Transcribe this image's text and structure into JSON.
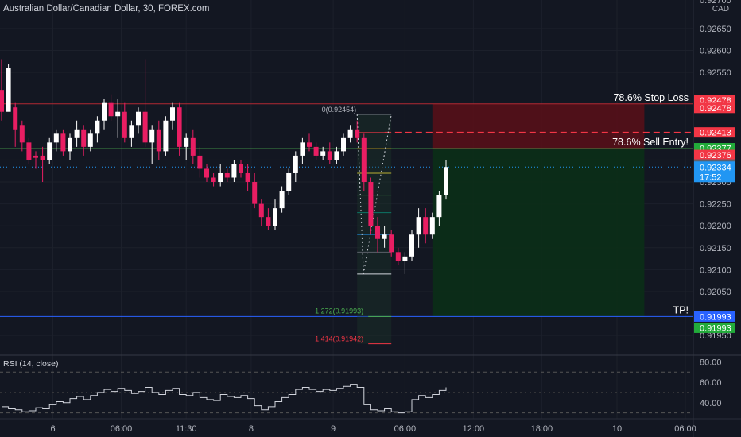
{
  "header": {
    "symbol_title": "Australian Dollar/Canadian Dollar, 30, FOREX.com",
    "currency": "CAD"
  },
  "chart_data": {
    "type": "candlestick",
    "price_axis": {
      "ylim": [
        0.91905,
        0.92715
      ],
      "ticks": [
        0.9265,
        0.926,
        0.9255,
        0.9235,
        0.923,
        0.9225,
        0.922,
        0.9215,
        0.921,
        0.9205,
        0.9195
      ],
      "tick_labels": [
        "0.92650",
        "0.92600",
        "0.92550",
        "0.92350",
        "0.92300",
        "0.92250",
        "0.92200",
        "0.92150",
        "0.92100",
        "0.92050",
        "0.91950"
      ],
      "top_partial_label": "0.92700"
    },
    "time_axis": {
      "labels": [
        {
          "t": 7.5,
          "text": "6"
        },
        {
          "t": 17.5,
          "text": "06:00"
        },
        {
          "t": 27,
          "text": "11:30"
        },
        {
          "t": 36.5,
          "text": "8"
        },
        {
          "t": 48.5,
          "text": "9"
        },
        {
          "t": 59,
          "text": "06:00"
        },
        {
          "t": 69,
          "text": "12:00"
        },
        {
          "t": 79,
          "text": "18:00"
        },
        {
          "t": 90,
          "text": "10"
        },
        {
          "t": 100,
          "text": "06:00"
        }
      ]
    },
    "candles": [
      {
        "o": 0.9251,
        "h": 0.9258,
        "l": 0.9244,
        "c": 0.9246
      },
      {
        "o": 0.9246,
        "h": 0.9257,
        "l": 0.9247,
        "c": 0.9256
      },
      {
        "o": 0.9247,
        "h": 0.9248,
        "l": 0.9238,
        "c": 0.9242
      },
      {
        "o": 0.9243,
        "h": 0.9244,
        "l": 0.9237,
        "c": 0.9239
      },
      {
        "o": 0.9239,
        "h": 0.924,
        "l": 0.9234,
        "c": 0.9235
      },
      {
        "o": 0.9236,
        "h": 0.9237,
        "l": 0.9233,
        "c": 0.92355
      },
      {
        "o": 0.9236,
        "h": 0.9238,
        "l": 0.923,
        "c": 0.9235
      },
      {
        "o": 0.9235,
        "h": 0.924,
        "l": 0.9234,
        "c": 0.9239
      },
      {
        "o": 0.9239,
        "h": 0.9242,
        "l": 0.9237,
        "c": 0.9241
      },
      {
        "o": 0.9241,
        "h": 0.9242,
        "l": 0.9236,
        "c": 0.9237
      },
      {
        "o": 0.9237,
        "h": 0.9241,
        "l": 0.9235,
        "c": 0.924
      },
      {
        "o": 0.924,
        "h": 0.9244,
        "l": 0.9238,
        "c": 0.9242
      },
      {
        "o": 0.9242,
        "h": 0.9243,
        "l": 0.9236,
        "c": 0.9238
      },
      {
        "o": 0.9238,
        "h": 0.9242,
        "l": 0.9237,
        "c": 0.9241
      },
      {
        "o": 0.9241,
        "h": 0.9245,
        "l": 0.9239,
        "c": 0.9244
      },
      {
        "o": 0.9244,
        "h": 0.9249,
        "l": 0.9242,
        "c": 0.9248
      },
      {
        "o": 0.9248,
        "h": 0.925,
        "l": 0.9244,
        "c": 0.9245
      },
      {
        "o": 0.9245,
        "h": 0.9249,
        "l": 0.924,
        "c": 0.9246
      },
      {
        "o": 0.9246,
        "h": 0.9248,
        "l": 0.9239,
        "c": 0.924
      },
      {
        "o": 0.924,
        "h": 0.9244,
        "l": 0.9238,
        "c": 0.9243
      },
      {
        "o": 0.9243,
        "h": 0.9247,
        "l": 0.9241,
        "c": 0.9246
      },
      {
        "o": 0.9246,
        "h": 0.9258,
        "l": 0.9238,
        "c": 0.9239
      },
      {
        "o": 0.9239,
        "h": 0.9243,
        "l": 0.9234,
        "c": 0.9242
      },
      {
        "o": 0.9242,
        "h": 0.9244,
        "l": 0.9235,
        "c": 0.9237
      },
      {
        "o": 0.9237,
        "h": 0.9245,
        "l": 0.9236,
        "c": 0.9244
      },
      {
        "o": 0.9244,
        "h": 0.9248,
        "l": 0.9242,
        "c": 0.9247
      },
      {
        "o": 0.9247,
        "h": 0.9248,
        "l": 0.9236,
        "c": 0.9238
      },
      {
        "o": 0.9238,
        "h": 0.9241,
        "l": 0.9235,
        "c": 0.924
      },
      {
        "o": 0.924,
        "h": 0.9242,
        "l": 0.9234,
        "c": 0.9236
      },
      {
        "o": 0.9236,
        "h": 0.9238,
        "l": 0.9231,
        "c": 0.9233
      },
      {
        "o": 0.9233,
        "h": 0.9234,
        "l": 0.923,
        "c": 0.9231
      },
      {
        "o": 0.9231,
        "h": 0.9232,
        "l": 0.9229,
        "c": 0.923
      },
      {
        "o": 0.923,
        "h": 0.9234,
        "l": 0.9229,
        "c": 0.9232
      },
      {
        "o": 0.9232,
        "h": 0.9233,
        "l": 0.923,
        "c": 0.9231
      },
      {
        "o": 0.9231,
        "h": 0.9235,
        "l": 0.923,
        "c": 0.9234
      },
      {
        "o": 0.9234,
        "h": 0.9235,
        "l": 0.9231,
        "c": 0.9232
      },
      {
        "o": 0.9232,
        "h": 0.9234,
        "l": 0.9228,
        "c": 0.923
      },
      {
        "o": 0.923,
        "h": 0.9232,
        "l": 0.9224,
        "c": 0.9225
      },
      {
        "o": 0.9225,
        "h": 0.9226,
        "l": 0.922,
        "c": 0.9222
      },
      {
        "o": 0.9222,
        "h": 0.9224,
        "l": 0.9219,
        "c": 0.922
      },
      {
        "o": 0.922,
        "h": 0.9226,
        "l": 0.9219,
        "c": 0.9224
      },
      {
        "o": 0.9224,
        "h": 0.9229,
        "l": 0.9223,
        "c": 0.9228
      },
      {
        "o": 0.9228,
        "h": 0.9233,
        "l": 0.9227,
        "c": 0.9232
      },
      {
        "o": 0.9232,
        "h": 0.9237,
        "l": 0.923,
        "c": 0.9236
      },
      {
        "o": 0.9236,
        "h": 0.924,
        "l": 0.9234,
        "c": 0.9239
      },
      {
        "o": 0.9239,
        "h": 0.9241,
        "l": 0.9237,
        "c": 0.9238
      },
      {
        "o": 0.9238,
        "h": 0.9239,
        "l": 0.9235,
        "c": 0.9236
      },
      {
        "o": 0.9236,
        "h": 0.9238,
        "l": 0.9235,
        "c": 0.9237
      },
      {
        "o": 0.9237,
        "h": 0.9239,
        "l": 0.9234,
        "c": 0.9235
      },
      {
        "o": 0.9235,
        "h": 0.9238,
        "l": 0.9234,
        "c": 0.9237
      },
      {
        "o": 0.9237,
        "h": 0.9241,
        "l": 0.9236,
        "c": 0.924
      },
      {
        "o": 0.924,
        "h": 0.9243,
        "l": 0.9239,
        "c": 0.9242
      },
      {
        "o": 0.9242,
        "h": 0.9244,
        "l": 0.9239,
        "c": 0.924
      },
      {
        "o": 0.924,
        "h": 0.9241,
        "l": 0.9228,
        "c": 0.923
      },
      {
        "o": 0.923,
        "h": 0.9231,
        "l": 0.9218,
        "c": 0.922
      },
      {
        "o": 0.922,
        "h": 0.9222,
        "l": 0.9214,
        "c": 0.9217
      },
      {
        "o": 0.9217,
        "h": 0.922,
        "l": 0.9215,
        "c": 0.9218
      },
      {
        "o": 0.9218,
        "h": 0.9219,
        "l": 0.9213,
        "c": 0.9214
      },
      {
        "o": 0.9214,
        "h": 0.9215,
        "l": 0.9211,
        "c": 0.9212
      },
      {
        "o": 0.9212,
        "h": 0.9214,
        "l": 0.9209,
        "c": 0.9213
      },
      {
        "o": 0.9213,
        "h": 0.9219,
        "l": 0.9212,
        "c": 0.9218
      },
      {
        "o": 0.9218,
        "h": 0.9224,
        "l": 0.9215,
        "c": 0.9222
      },
      {
        "o": 0.9222,
        "h": 0.9224,
        "l": 0.9216,
        "c": 0.9218
      },
      {
        "o": 0.9218,
        "h": 0.9223,
        "l": 0.9217,
        "c": 0.9222
      },
      {
        "o": 0.9222,
        "h": 0.9228,
        "l": 0.922,
        "c": 0.9227
      },
      {
        "o": 0.9227,
        "h": 0.9235,
        "l": 0.9226,
        "c": 0.92334
      }
    ],
    "levels": {
      "stop_loss": {
        "price": 0.92478,
        "label": "78.6% Stop Loss"
      },
      "entry": {
        "price": 0.92376,
        "label": "78.6% Sell Entry!"
      },
      "tp": {
        "price": 0.91993,
        "label": "TP!"
      },
      "current": 0.92334
    },
    "position": {
      "start_t": 63,
      "end_t": 94
    },
    "fib": {
      "start_t": 52,
      "end_t": 57,
      "top_label": "0(0.92454)",
      "high": 0.92454,
      "low": 0.9209,
      "internal_levels": [
        0.92413,
        0.92376,
        0.9232,
        0.9227,
        0.9223,
        0.9218,
        0.9214
      ],
      "ext1": {
        "price": 0.91993,
        "label": "1.272(0.91993)"
      },
      "ext2": {
        "price": 0.91942,
        "label": "1.414(0.91942)"
      }
    },
    "price_badges": [
      {
        "price": 0.92478,
        "text": "0.92478",
        "color": "#f23645",
        "offset": -5
      },
      {
        "price": 0.92478,
        "text": "0.92478",
        "color": "#f23645",
        "offset": 5
      },
      {
        "price": 0.92413,
        "text": "0.92413",
        "color": "#f23645",
        "offset": 0
      },
      {
        "price": 0.92377,
        "text": "0.92377",
        "color": "#22ab3a",
        "offset": 0
      },
      {
        "price": 0.92376,
        "text": "0.92376",
        "color": "#f23645",
        "offset": 8
      },
      {
        "price": 0.92376,
        "text": "0.92376",
        "color": "#5d606b",
        "offset": 20
      },
      {
        "price": 0.91993,
        "text": "0.91993",
        "color": "#2962ff",
        "offset": 0
      },
      {
        "price": 0.91993,
        "text": "0.91993",
        "color": "#22ab3a",
        "offset": 14
      }
    ],
    "current_badge": {
      "price_text": "0.92334",
      "countdown": "17:52",
      "color": "#2196f3"
    },
    "rsi": {
      "title": "RSI (14, close)",
      "ylim": [
        25,
        85
      ],
      "levels": [
        70,
        30
      ],
      "ticks": [
        {
          "v": 80,
          "text": "80.00"
        },
        {
          "v": 60,
          "text": "60.00"
        },
        {
          "v": 40,
          "text": "40.00"
        }
      ],
      "values": [
        36,
        34,
        33,
        31,
        32,
        35,
        34,
        38,
        41,
        40,
        44,
        46,
        43,
        47,
        50,
        53,
        51,
        54,
        52,
        49,
        51,
        55,
        50,
        48,
        52,
        54,
        48,
        47,
        50,
        45,
        43,
        42,
        48,
        46,
        45,
        47,
        44,
        37,
        33,
        36,
        41,
        45,
        48,
        53,
        55,
        53,
        51,
        53,
        52,
        54,
        56,
        58,
        55,
        38,
        33,
        32,
        34,
        31,
        30,
        31,
        43,
        47,
        45,
        48,
        52,
        55
      ]
    }
  }
}
